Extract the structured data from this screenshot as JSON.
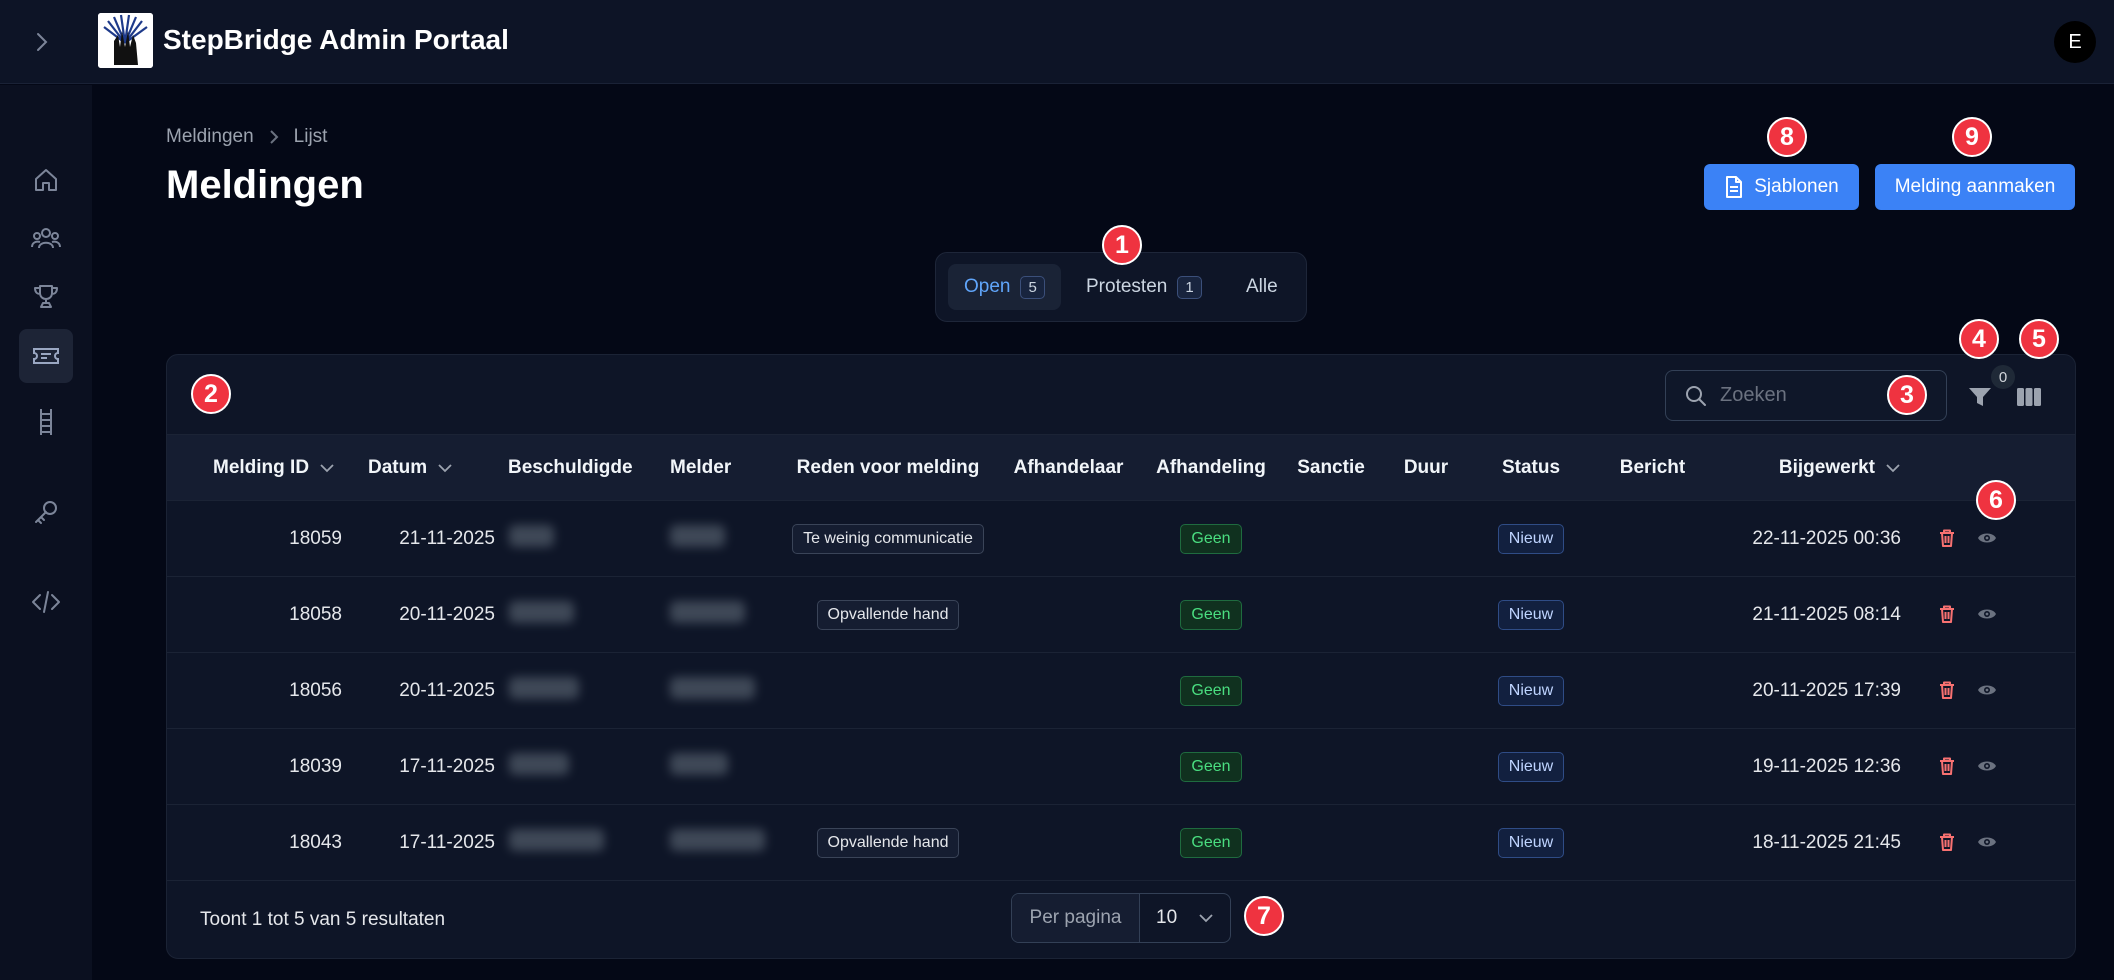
{
  "app": {
    "title": "StepBridge Admin Portaal",
    "avatar_initial": "E"
  },
  "breadcrumb": {
    "parent": "Meldingen",
    "current": "Lijst"
  },
  "page": {
    "title": "Meldingen"
  },
  "actions": {
    "templates_label": "Sjablonen",
    "create_label": "Melding aanmaken"
  },
  "tabs": [
    {
      "label": "Open",
      "count": "5"
    },
    {
      "label": "Protesten",
      "count": "1"
    },
    {
      "label": "Alle"
    }
  ],
  "search": {
    "placeholder": "Zoeken"
  },
  "filter": {
    "count": "0"
  },
  "table": {
    "headers": {
      "id": "Melding ID",
      "date": "Datum",
      "accused": "Beschuldigde",
      "reporter": "Melder",
      "reason": "Reden voor melding",
      "handler": "Afhandelaar",
      "handling": "Afhandeling",
      "sanction": "Sanctie",
      "duration": "Duur",
      "status": "Status",
      "message": "Bericht",
      "updated": "Bijgewerkt"
    },
    "rows": [
      {
        "id": "18059",
        "date": "21-11-2025",
        "reason": "Te weinig communicatie",
        "handling": "Geen",
        "status": "Nieuw",
        "updated": "22-11-2025 00:36"
      },
      {
        "id": "18058",
        "date": "20-11-2025",
        "reason": "Opvallende hand",
        "handling": "Geen",
        "status": "Nieuw",
        "updated": "21-11-2025 08:14"
      },
      {
        "id": "18056",
        "date": "20-11-2025",
        "reason": "",
        "handling": "Geen",
        "status": "Nieuw",
        "updated": "20-11-2025 17:39"
      },
      {
        "id": "18039",
        "date": "17-11-2025",
        "reason": "",
        "handling": "Geen",
        "status": "Nieuw",
        "updated": "19-11-2025 12:36"
      },
      {
        "id": "18043",
        "date": "17-11-2025",
        "reason": "Opvallende hand",
        "handling": "Geen",
        "status": "Nieuw",
        "updated": "18-11-2025 21:45"
      }
    ]
  },
  "footer": {
    "summary": "Toont 1 tot 5 van 5 resultaten",
    "per_page_label": "Per pagina",
    "per_page_value": "10"
  },
  "annotations": [
    "1",
    "2",
    "3",
    "4",
    "5",
    "6",
    "7",
    "8",
    "9"
  ],
  "colors": {
    "accent": "#3b82f6",
    "annotation": "#ef3340",
    "success": "#4ade80"
  }
}
